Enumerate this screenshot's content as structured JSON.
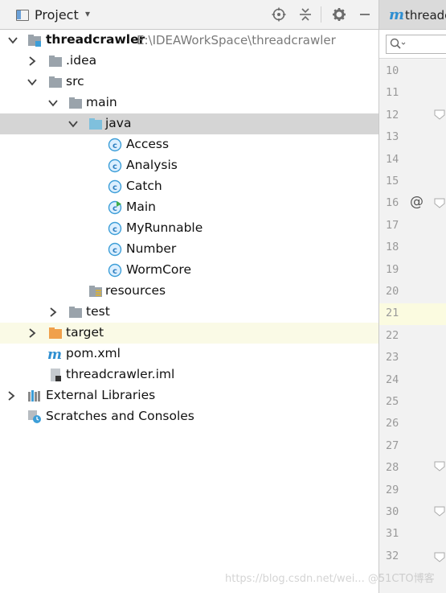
{
  "panel": {
    "title": "Project",
    "caret": "▾"
  },
  "tree": {
    "root": {
      "label": "threadcrawler",
      "path": "E:\\IDEAWorkSpace\\threadcrawler"
    },
    "idea": ".idea",
    "src": "src",
    "main": "main",
    "java": "java",
    "classes": [
      "Access",
      "Analysis",
      "Catch",
      "Main",
      "MyRunnable",
      "Number",
      "WormCore"
    ],
    "resources": "resources",
    "test": "test",
    "target": "target",
    "pom": "pom.xml",
    "iml": "threadcrawler.iml",
    "external_libraries": "External Libraries",
    "scratches": "Scratches and Consoles"
  },
  "editor": {
    "tab_logo": "m",
    "tab_label": "threadcrawler",
    "line_numbers": [
      "10",
      "11",
      "12",
      "13",
      "14",
      "15",
      "16",
      "17",
      "18",
      "19",
      "20",
      "21",
      "22",
      "23",
      "24",
      "25",
      "26",
      "27",
      "28",
      "29",
      "30",
      "31",
      "32"
    ],
    "annotation_glyph": "@"
  },
  "watermark": "https://blog.csdn.net/wei... @51CTO博客",
  "colors": {
    "selected_row": "#d5d5d5",
    "highlight_row": "#fafae6",
    "class_icon": "#3c9ed8",
    "folder_gray": "#9aa3ab",
    "folder_blue": "#7fc0dd",
    "folder_orange": "#f0a04b"
  }
}
